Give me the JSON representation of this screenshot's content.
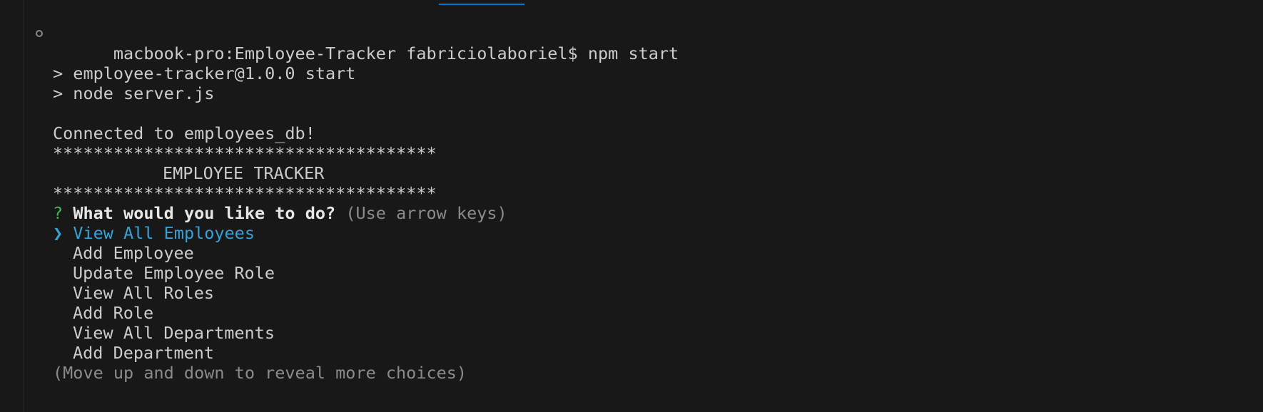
{
  "terminal": {
    "prompt_line": "macbook-pro:Employee-Tracker fabriciolaboriel$ npm start",
    "npm_output": [
      "> employee-tracker@1.0.0 start",
      "> node server.js"
    ],
    "connected": "Connected to employees_db!",
    "stars": "**************************************",
    "banner_title": "EMPLOYEE TRACKER",
    "question_mark": "?",
    "question": "What would you like to do?",
    "question_hint": "(Use arrow keys)",
    "pointer": "❯",
    "choices": [
      "View All Employees",
      "Add Employee",
      "Update Employee Role",
      "View All Roles",
      "Add Role",
      "View All Departments",
      "Add Department"
    ],
    "selected_index": 0,
    "footer_hint": "(Move up and down to reveal more choices)"
  },
  "colors": {
    "background": "#181818",
    "text": "#cccccc",
    "selected": "#39a0d3",
    "question_mark": "#3fb950",
    "hint": "#8b8b8b"
  }
}
